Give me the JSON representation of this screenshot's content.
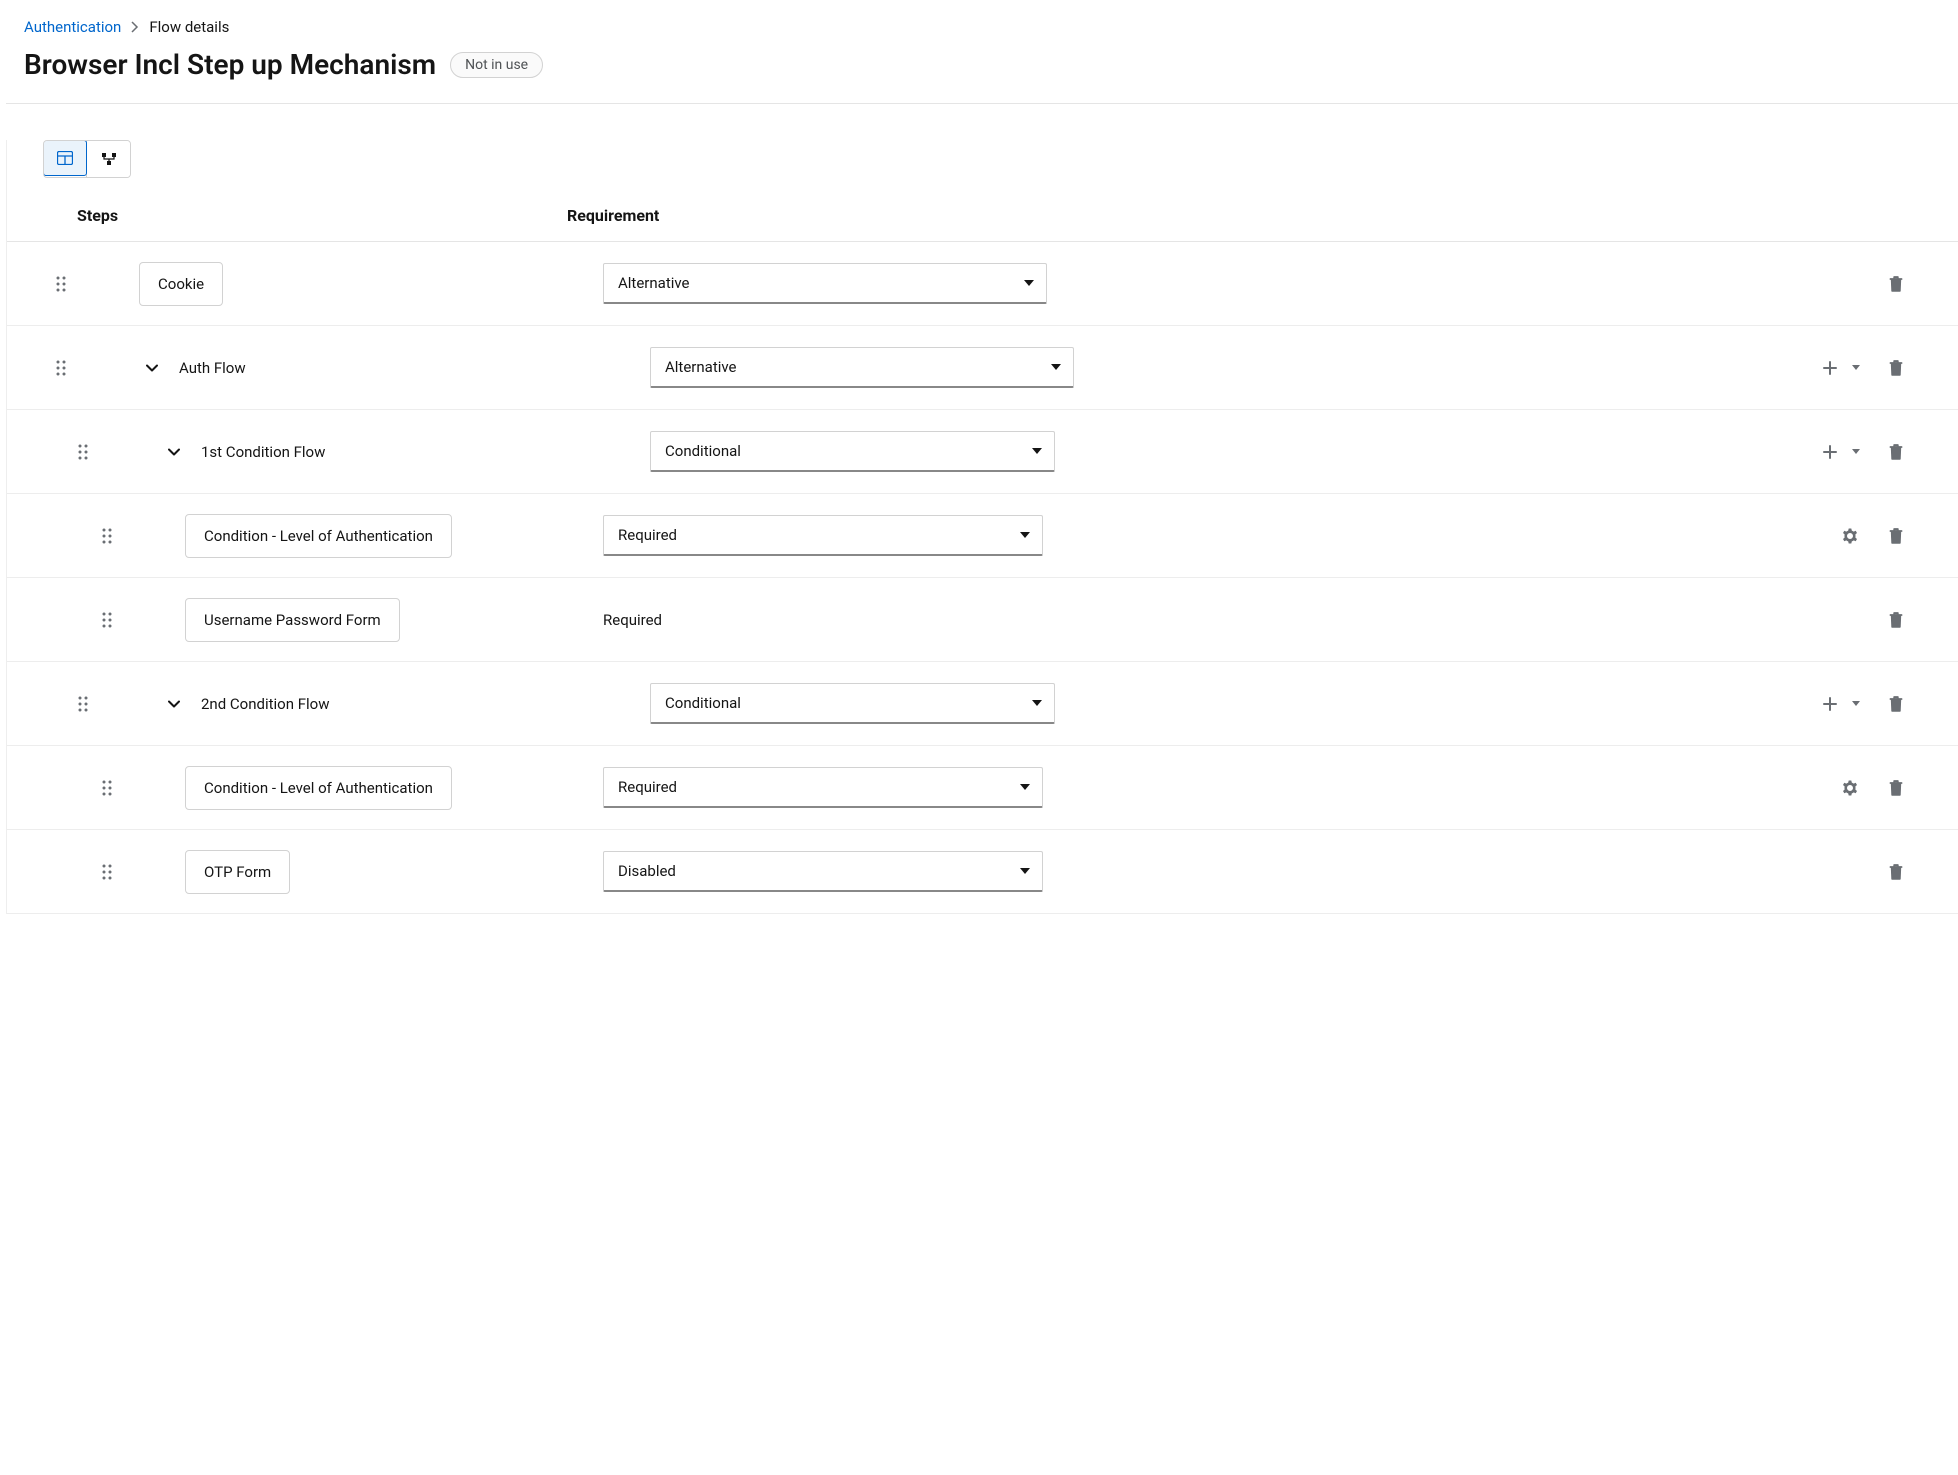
{
  "breadcrumb": {
    "parent": "Authentication",
    "current": "Flow details"
  },
  "title": "Browser Incl Step up Mechanism",
  "status_badge": "Not in use",
  "headers": {
    "steps": "Steps",
    "requirement": "Requirement"
  },
  "rows": [
    {
      "indent": 0,
      "drag_indent": 0,
      "has_expand": false,
      "chip": true,
      "label": "Cookie",
      "req_type": "select",
      "requirement": "Alternative",
      "step_width": 524,
      "select_width": 444,
      "actions": [
        "trash"
      ]
    },
    {
      "indent": 0,
      "drag_indent": 0,
      "has_expand": true,
      "chip": false,
      "label": "Auth Flow",
      "req_type": "select",
      "requirement": "Alternative",
      "step_width": 571,
      "select_width": 424,
      "actions": [
        "add-caret",
        "trash"
      ]
    },
    {
      "indent": 22,
      "drag_indent": 22,
      "has_expand": true,
      "chip": false,
      "label": "1st Condition Flow",
      "req_type": "select",
      "requirement": "Conditional",
      "step_width": 571,
      "select_width": 405,
      "actions": [
        "add-caret",
        "trash"
      ]
    },
    {
      "indent": 46,
      "drag_indent": 46,
      "has_expand": false,
      "chip": true,
      "label": "Condition - Level of Authentication",
      "req_type": "select",
      "requirement": "Required",
      "step_width": 524,
      "select_width": 440,
      "actions": [
        "gear",
        "trash"
      ]
    },
    {
      "indent": 46,
      "drag_indent": 46,
      "has_expand": false,
      "chip": true,
      "label": "Username Password Form",
      "req_type": "static",
      "requirement": "Required",
      "step_width": 524,
      "select_width": 440,
      "actions": [
        "trash"
      ]
    },
    {
      "indent": 22,
      "drag_indent": 22,
      "has_expand": true,
      "chip": false,
      "label": "2nd Condition Flow",
      "req_type": "select",
      "requirement": "Conditional",
      "step_width": 571,
      "select_width": 405,
      "actions": [
        "add-caret",
        "trash"
      ]
    },
    {
      "indent": 46,
      "drag_indent": 46,
      "has_expand": false,
      "chip": true,
      "label": "Condition - Level of Authentication",
      "req_type": "select",
      "requirement": "Required",
      "step_width": 524,
      "select_width": 440,
      "actions": [
        "gear",
        "trash"
      ]
    },
    {
      "indent": 46,
      "drag_indent": 46,
      "has_expand": false,
      "chip": true,
      "label": "OTP Form",
      "req_type": "select",
      "requirement": "Disabled",
      "step_width": 524,
      "select_width": 440,
      "actions": [
        "trash"
      ]
    }
  ]
}
